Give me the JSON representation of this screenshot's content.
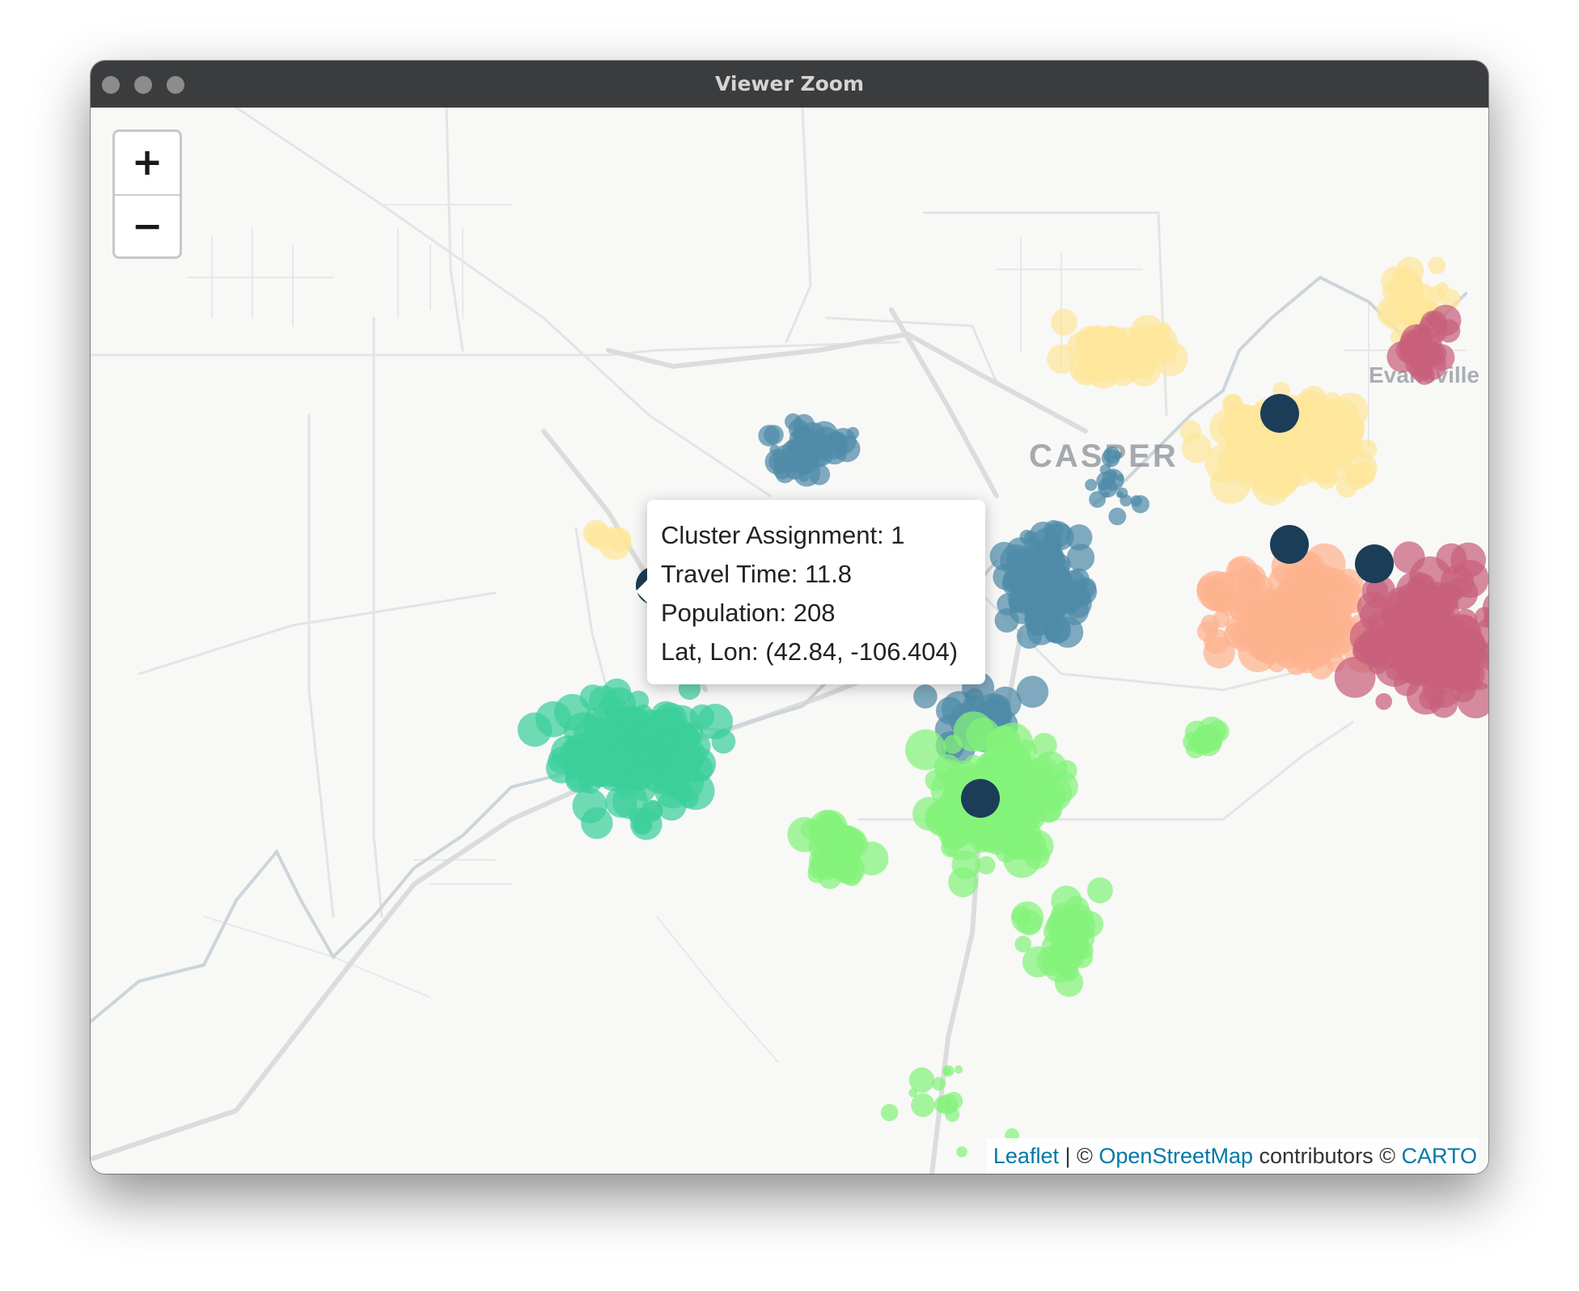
{
  "window": {
    "title": "Viewer Zoom"
  },
  "zoom": {
    "in_label": "+",
    "out_label": "−"
  },
  "map": {
    "place_labels": {
      "city": "CASPER",
      "town": "Evansville"
    },
    "colors": {
      "cluster_teal_blue": "#4f8aa8",
      "cluster_green_teal": "#3ccf9b",
      "cluster_light_green": "#84f27a",
      "cluster_yellow": "#fde69a",
      "cluster_peach": "#fdb38f",
      "cluster_rose": "#c8607b",
      "centroid": "#1c3d57"
    }
  },
  "popup": {
    "lines": [
      "Cluster Assignment: 1",
      "Travel Time: 11.8",
      "Population: 208",
      "Lat, Lon: (42.84, -106.404)"
    ]
  },
  "attribution": {
    "leaflet": "Leaflet",
    "sep1": " | © ",
    "osm": "OpenStreetMap",
    "contributors": " contributors © ",
    "carto": "CARTO"
  }
}
